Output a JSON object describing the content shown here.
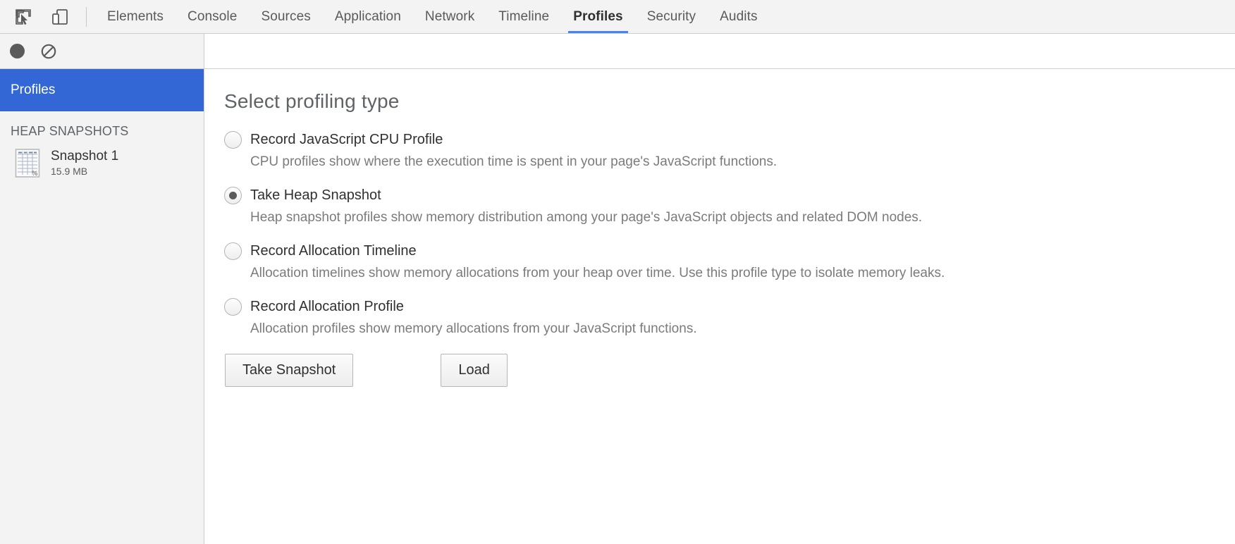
{
  "toolbar": {
    "inspect_icon": "inspect-element-icon",
    "device_icon": "toggle-device-toolbar-icon",
    "tabs": [
      {
        "label": "Elements",
        "active": false
      },
      {
        "label": "Console",
        "active": false
      },
      {
        "label": "Sources",
        "active": false
      },
      {
        "label": "Application",
        "active": false
      },
      {
        "label": "Network",
        "active": false
      },
      {
        "label": "Timeline",
        "active": false
      },
      {
        "label": "Profiles",
        "active": true
      },
      {
        "label": "Security",
        "active": false
      },
      {
        "label": "Audits",
        "active": false
      }
    ],
    "active_tab_underline_color": "#4285f4"
  },
  "subtoolbar": {
    "record_icon": "record-circle-icon",
    "clear_icon": "clear-all-icon"
  },
  "sidebar": {
    "header_label": "Profiles",
    "header_color": "#3367d6",
    "section_title": "HEAP SNAPSHOTS",
    "snapshots": [
      {
        "name": "Snapshot 1",
        "size": "15.9 MB",
        "icon": "heap-snapshot-icon"
      }
    ]
  },
  "main": {
    "title": "Select profiling type",
    "options": [
      {
        "label": "Record JavaScript CPU Profile",
        "selected": false,
        "description": "CPU profiles show where the execution time is spent in your page's JavaScript functions."
      },
      {
        "label": "Take Heap Snapshot",
        "selected": true,
        "description": "Heap snapshot profiles show memory distribution among your page's JavaScript objects and related DOM nodes."
      },
      {
        "label": "Record Allocation Timeline",
        "selected": false,
        "description": "Allocation timelines show memory allocations from your heap over time. Use this profile type to isolate memory leaks."
      },
      {
        "label": "Record Allocation Profile",
        "selected": false,
        "description": "Allocation profiles show memory allocations from your JavaScript functions."
      }
    ],
    "primary_button": "Take Snapshot",
    "secondary_button": "Load"
  }
}
